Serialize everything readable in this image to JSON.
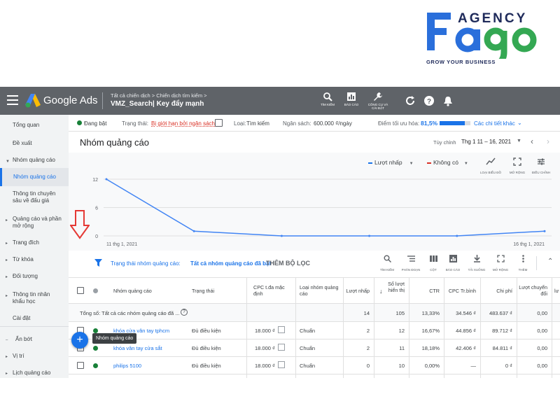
{
  "brand": {
    "agency": "AGENCY",
    "wordmark": "Fago",
    "tagline": "GROW YOUR BUSINESS",
    "colors": {
      "blue": "#2a6fdb",
      "green": "#34a853",
      "navy": "#1e2a5a"
    }
  },
  "topbar": {
    "product": "Google Ads",
    "breadcrumb": "Tất cả chiến dịch  >  Chiến dịch tìm kiếm  >",
    "campaign": "VMZ_Search| Key đẩy mạnh",
    "tools": [
      {
        "label": "TÌM KIẾM",
        "icon": "search-icon"
      },
      {
        "label": "BÁO CÁO",
        "icon": "reports-icon"
      },
      {
        "label": "CÔNG CỤ VÀ CÀI ĐẶT",
        "icon": "wrench-icon"
      }
    ],
    "icons": [
      "refresh-icon",
      "help-icon",
      "bell-icon"
    ]
  },
  "sidebar": {
    "items": [
      {
        "label": "Tổng quan"
      },
      {
        "label": "Đề xuất"
      },
      {
        "label": "Nhóm quảng cáo"
      },
      {
        "label": "Nhóm quảng cáo"
      },
      {
        "label": "Thông tin chuyên sâu về đấu giá"
      },
      {
        "label": "Quảng cáo và phần mở rộng"
      },
      {
        "label": "Trang đích"
      },
      {
        "label": "Từ khóa"
      },
      {
        "label": "Đối tượng"
      },
      {
        "label": "Thông tin nhân khẩu học"
      },
      {
        "label": "Cài đặt"
      },
      {
        "label": "Ẩn bớt"
      },
      {
        "label": "Vị trí"
      },
      {
        "label": "Lịch quảng cáo"
      }
    ]
  },
  "status": {
    "state": "Đang bật",
    "state_label": "Trạng thái:",
    "state_value": "Bị giới hạn bởi ngân sách",
    "type_label": "Loại:",
    "type_value": "Tìm kiếm",
    "budget_label": "Ngân sách:",
    "budget_value": "600.000 ₫/ngày",
    "opt_label": "Điểm tối ưu hóa:",
    "opt_value": "81,5%",
    "opt_fraction": 0.815,
    "details_link": "Các chi tiết khác"
  },
  "page": {
    "title": "Nhóm quảng cáo",
    "date_label": "Tùy chỉnh",
    "date_range": "Thg 1 11 – 16, 2021"
  },
  "chart": {
    "metric1": "Lượt nhấp",
    "metric2": "Không có",
    "tools": [
      {
        "label": "LOẠI BIỂU ĐỒ",
        "icon": "chart-type-icon"
      },
      {
        "label": "MỞ RỘNG",
        "icon": "expand-icon"
      },
      {
        "label": "ĐIỀU CHỈNH",
        "icon": "tune-icon"
      }
    ],
    "x_start": "11 thg 1, 2021",
    "x_end": "16 thg 1, 2021",
    "y_ticks": [
      "12",
      "6",
      "0"
    ],
    "values": [
      12,
      1,
      0,
      0,
      0,
      1
    ],
    "y_max": 12,
    "line_color": "#4285f4"
  },
  "fab": {
    "symbol": "+",
    "tooltip": "Nhóm quảng cáo"
  },
  "filter": {
    "label": "Trạng thái nhóm quảng cáo:",
    "value": "Tất cả nhóm quảng cáo đã bật",
    "add_filter": "THÊM BỘ LỌC"
  },
  "table_tools": [
    {
      "label": "TÌM KIẾM",
      "icon": "search-icon"
    },
    {
      "label": "PHÂN ĐOẠN",
      "icon": "segment-icon"
    },
    {
      "label": "CỘT",
      "icon": "columns-icon"
    },
    {
      "label": "BÁO CÁO",
      "icon": "reports-icon"
    },
    {
      "label": "TẢI XUỐNG",
      "icon": "download-icon"
    },
    {
      "label": "MỞ RỘNG",
      "icon": "expand-icon"
    },
    {
      "label": "THÊM",
      "icon": "more-icon"
    }
  ],
  "table": {
    "headers": {
      "name": "Nhóm quảng cáo",
      "status": "Trạng thái",
      "cpc": "CPC t.đa mặc định",
      "type": "Loại nhóm quảng cáo",
      "clicks": "Lượt nhấp",
      "impr": "Số lượt hiển thị",
      "ctr": "CTR",
      "avgcpc": "CPC Tr.bình",
      "cost": "Chi phí",
      "conv": "Lượt chuyển đổi",
      "more": "lư"
    },
    "total": {
      "label": "Tổng số: Tất cả các nhóm quảng cáo đã ...",
      "clicks": "14",
      "impr": "105",
      "ctr": "13,33%",
      "avgcpc": "34.546 ₫",
      "cost": "483.637 ₫",
      "conv": "0,00"
    },
    "rows": [
      {
        "name": "khóa cửa vân tay tphcm",
        "status": "Đủ điều kiện",
        "cpc": "18.000 ₫",
        "type": "Chuẩn",
        "clicks": "2",
        "impr": "12",
        "ctr": "16,67%",
        "avgcpc": "44.856 ₫",
        "cost": "89.712 ₫",
        "conv": "0,00"
      },
      {
        "name": "khóa vân tay cửa sắt",
        "status": "Đủ điều kiện",
        "cpc": "18.000 ₫",
        "type": "Chuẩn",
        "clicks": "2",
        "impr": "11",
        "ctr": "18,18%",
        "avgcpc": "42.406 ₫",
        "cost": "84.811 ₫",
        "conv": "0,00"
      },
      {
        "name": "philips 5100",
        "status": "Đủ điều kiện",
        "cpc": "18.000 ₫",
        "type": "Chuẩn",
        "clicks": "0",
        "impr": "10",
        "ctr": "0,00%",
        "avgcpc": "—",
        "cost": "0 ₫",
        "conv": "0,00"
      }
    ]
  }
}
